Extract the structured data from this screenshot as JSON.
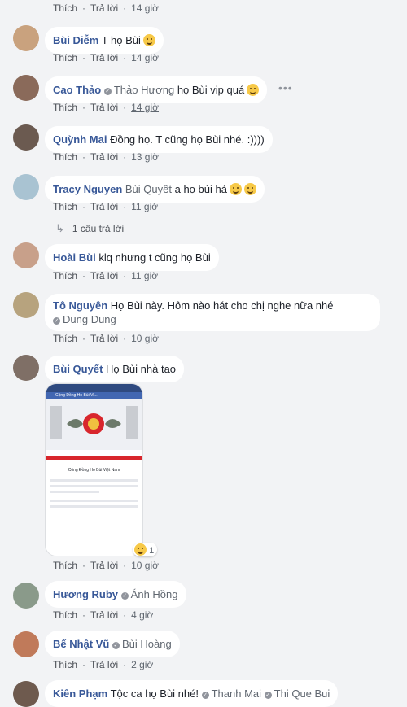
{
  "actions": {
    "like": "Thích",
    "reply": "Trả lời",
    "sep": "·"
  },
  "top_partial": {
    "time": "14 giờ"
  },
  "comments": [
    {
      "author": "Bùi Diễm",
      "text": "T họ Bùi",
      "time": "14 giờ"
    },
    {
      "author": "Cao Thảo",
      "tag": "Thảo Hương",
      "text": "họ Bùi vip quá",
      "time": "14 giờ"
    },
    {
      "author": "Quỳnh Mai",
      "text": "Đồng họ. T cũng họ Bùi nhé. :))))",
      "time": "13 giờ"
    },
    {
      "author": "Tracy Nguyen",
      "tag": "Bùi Quyết",
      "text": "a họ bùi hả",
      "time": "11 giờ"
    },
    {
      "author": "Hoài Bùi",
      "text": "klq nhưng t cũng họ Bùi",
      "time": "11 giờ"
    },
    {
      "author": "Tô Nguyên",
      "text": "Họ Bùi này. Hôm nào hát cho chị nghe nữa nhé",
      "tag": "Dung Dung",
      "time": "10 giờ"
    },
    {
      "author": "Bùi Quyết",
      "text": "Họ Bùi nhà tao",
      "time": "10 giờ",
      "reaction_count": "1"
    },
    {
      "author": "Hương Ruby",
      "tag": "Ánh Hồng",
      "time": "4 giờ"
    },
    {
      "author": "Bế Nhật Vũ",
      "tag": "Bùi Hoàng",
      "time": "2 giờ"
    },
    {
      "author": "Kiên Phạm",
      "text": "Tộc ca họ Bùi nhé!",
      "tag": "Thanh Mai",
      "tag2": "Thi Que Bui"
    }
  ],
  "replies_link": "1 câu trả lời",
  "more_label": "•••",
  "screenshot_text": {
    "top": "Cộng Đồng Họ Bùi Vi...",
    "title": "Cộng Đồng Họ Bùi Việt Nam"
  },
  "colors": {
    "author": "#385898",
    "bubble": "#ffffff",
    "page": "#f2f3f5"
  }
}
